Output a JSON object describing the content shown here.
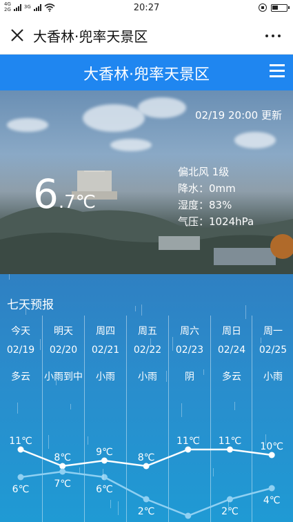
{
  "status": {
    "network_tag1": "4G",
    "network_tag2": "2G",
    "network_tag3": "3G",
    "time": "20:27"
  },
  "nav": {
    "title": "大香林·兜率天景区"
  },
  "app": {
    "title": "大香林·兜率天景区"
  },
  "current": {
    "update": "02/19 20:00 更新",
    "temp_int": "6",
    "temp_dec": ".7℃",
    "wind": "偏北风 1级",
    "precip": "降水：0mm",
    "humidity": "湿度：83%",
    "pressure": "气压：1024hPa"
  },
  "forecast": {
    "title": "七天预报",
    "days": [
      {
        "day": "今天",
        "date": "02/19",
        "cond": "多云",
        "high": "11℃",
        "low": "6℃"
      },
      {
        "day": "明天",
        "date": "02/20",
        "cond": "小雨到中",
        "high": "8℃",
        "low": "7℃"
      },
      {
        "day": "周四",
        "date": "02/21",
        "cond": "小雨",
        "high": "9℃",
        "low": "6℃"
      },
      {
        "day": "周五",
        "date": "02/22",
        "cond": "小雨",
        "high": "8℃",
        "low": "2℃"
      },
      {
        "day": "周六",
        "date": "02/23",
        "cond": "阴",
        "high": "11℃",
        "low": "-1℃"
      },
      {
        "day": "周日",
        "date": "02/24",
        "cond": "多云",
        "high": "11℃",
        "low": "2℃"
      },
      {
        "day": "周一",
        "date": "02/25",
        "cond": "小雨",
        "high": "10℃",
        "low": "4℃"
      }
    ]
  },
  "chart_data": {
    "type": "line",
    "categories": [
      "02/19",
      "02/20",
      "02/21",
      "02/22",
      "02/23",
      "02/24",
      "02/25"
    ],
    "series": [
      {
        "values": [
          11,
          8,
          9,
          8,
          11,
          11,
          10
        ],
        "color": "#ffffff"
      },
      {
        "values": [
          6,
          7,
          6,
          2,
          -1,
          2,
          4
        ],
        "color": "#8fd0f2"
      }
    ]
  }
}
